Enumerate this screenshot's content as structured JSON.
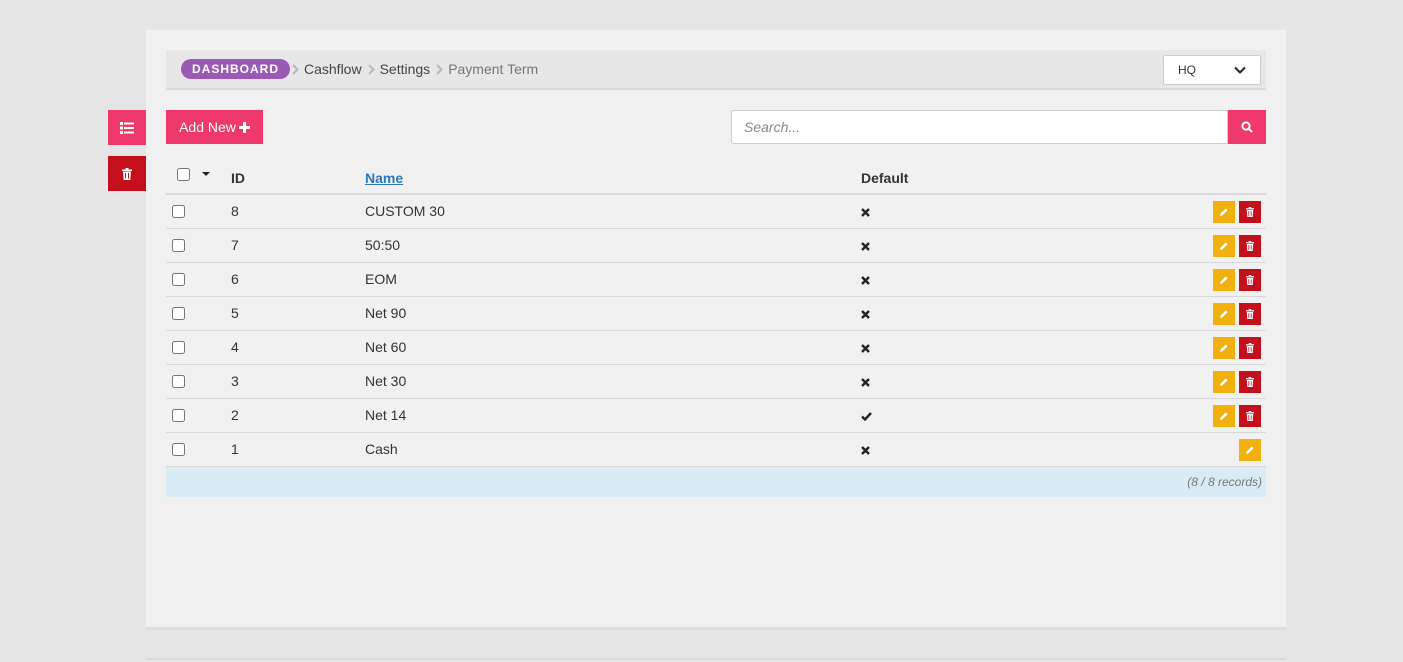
{
  "breadcrumb": {
    "home": "DASHBOARD",
    "items": [
      "Cashflow",
      "Settings"
    ],
    "current": "Payment Term"
  },
  "site_select": {
    "value": "HQ"
  },
  "toolbar": {
    "add_label": "Add New"
  },
  "search": {
    "placeholder": "Search..."
  },
  "table": {
    "headers": {
      "id": "ID",
      "name": "Name",
      "default": "Default"
    },
    "rows": [
      {
        "id": "8",
        "name": "CUSTOM 30",
        "default": false,
        "deletable": true
      },
      {
        "id": "7",
        "name": "50:50",
        "default": false,
        "deletable": true
      },
      {
        "id": "6",
        "name": "EOM",
        "default": false,
        "deletable": true
      },
      {
        "id": "5",
        "name": "Net 90",
        "default": false,
        "deletable": true
      },
      {
        "id": "4",
        "name": "Net 60",
        "default": false,
        "deletable": true
      },
      {
        "id": "3",
        "name": "Net 30",
        "default": false,
        "deletable": true
      },
      {
        "id": "2",
        "name": "Net 14",
        "default": true,
        "deletable": true
      },
      {
        "id": "1",
        "name": "Cash",
        "default": false,
        "deletable": false
      }
    ],
    "records": "(8 / 8 records)"
  },
  "colors": {
    "accent": "#f0396b",
    "danger": "#c4101c",
    "warning": "#f1b00e",
    "badge": "#9b59b6",
    "footer": "#d9ebf5",
    "link": "#2a76c2"
  },
  "icons": {
    "side_list": "list-icon",
    "side_trash": "trash-icon",
    "add": "plus-icon",
    "search": "search-icon",
    "edit": "pencil-icon",
    "delete": "trash-icon",
    "default_true": "check-icon",
    "default_false": "times-icon",
    "select": "chevron-down-icon"
  }
}
